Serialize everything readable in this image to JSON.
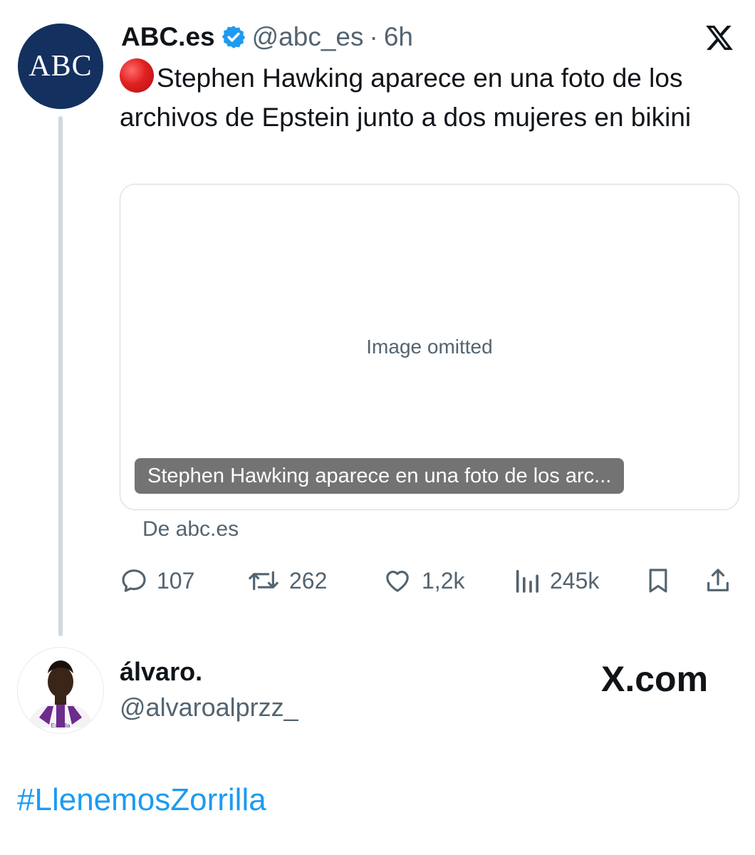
{
  "tweet": {
    "author_avatar_text": "ABC",
    "display_name": "ABC.es",
    "handle": "@abc_es",
    "separator": "·",
    "time": "6h",
    "text": "Stephen Hawking aparece en una foto de los archivos de Epstein junto a dos mujeres en bikini",
    "platform_icon": "x-logo-icon",
    "card": {
      "caption": "Stephen Hawking aparece en una foto de los arc...",
      "source": "De abc.es"
    },
    "actions": {
      "replies": "107",
      "reposts": "262",
      "likes": "1,2k",
      "views": "245k"
    }
  },
  "reply_author": {
    "display_name": "álvaro.",
    "handle": "@alvaroalprzz_"
  },
  "watermark": "X.com",
  "hashtag": "#LlenemosZorrilla",
  "colors": {
    "accent_blue": "#1d9bf0",
    "abc_navy": "#14305f",
    "muted_text": "#536471",
    "alert_red": "#e0201f"
  }
}
